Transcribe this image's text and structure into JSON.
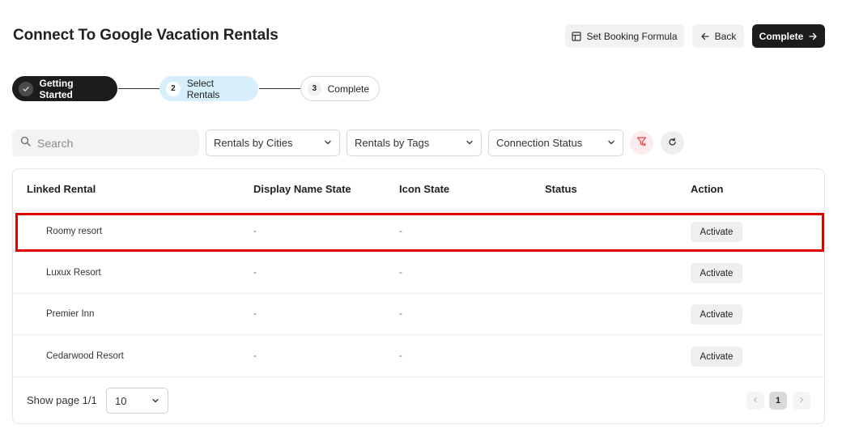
{
  "header": {
    "title": "Connect To Google Vacation Rentals",
    "set_booking_formula": "Set Booking Formula",
    "back": "Back",
    "complete": "Complete"
  },
  "stepper": {
    "steps": [
      {
        "num": "",
        "label": "Getting Started",
        "state": "done",
        "icon": "check-icon"
      },
      {
        "num": "2",
        "label": "Select Rentals",
        "state": "active"
      },
      {
        "num": "3",
        "label": "Complete",
        "state": "todo"
      }
    ]
  },
  "filters": {
    "search_placeholder": "Search",
    "cities": "Rentals by Cities",
    "tags": "Rentals by Tags",
    "status": "Connection Status"
  },
  "table": {
    "columns": [
      "Linked Rental",
      "Display Name State",
      "Icon State",
      "Status",
      "Action"
    ],
    "rows": [
      {
        "name": "Roomy resort",
        "display": "-",
        "icon": "-",
        "status": "",
        "action": "Activate"
      },
      {
        "name": "Luxux Resort",
        "display": "-",
        "icon": "-",
        "status": "",
        "action": "Activate"
      },
      {
        "name": "Premier Inn",
        "display": "-",
        "icon": "-",
        "status": "",
        "action": "Activate"
      },
      {
        "name": "Cedarwood Resort",
        "display": "-",
        "icon": "-",
        "status": "",
        "action": "Activate"
      }
    ]
  },
  "pagination": {
    "label": "Show page 1/1",
    "page_size": "10",
    "current_page": "1"
  },
  "colors": {
    "dark_button": "#1c1c1c",
    "active_step": "#d7eefc",
    "highlight": "#e00000",
    "filter_icon": "#e04848"
  }
}
